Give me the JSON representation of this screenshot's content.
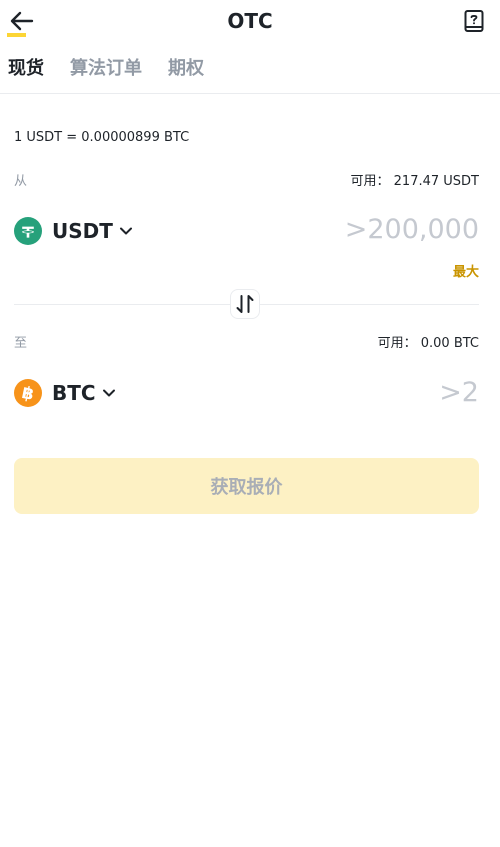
{
  "header": {
    "title": "OTC",
    "back_icon": "arrow-left-icon",
    "guide_icon": "book-question-icon"
  },
  "tabs": [
    {
      "label": "现货",
      "active": true
    },
    {
      "label": "算法订单",
      "active": false
    },
    {
      "label": "期权",
      "active": false
    }
  ],
  "rate_text": "1 USDT = 0.00000899 BTC",
  "from": {
    "label": "从",
    "available": "可用： 217.47 USDT",
    "coin": "USDT",
    "coin_icon": "tether-icon",
    "coin_color": "#26a17b",
    "amount_placeholder": ">200,000",
    "max_label": "最大"
  },
  "to": {
    "label": "至",
    "available": "可用： 0.00 BTC",
    "coin": "BTC",
    "coin_icon": "bitcoin-icon",
    "coin_color": "#f7931a",
    "amount_placeholder": ">2"
  },
  "swap_icon": "swap-vertical-icon",
  "quote_button": "获取报价",
  "colors": {
    "accent": "#fcd535",
    "max_link": "#c99400",
    "button_disabled_bg": "#fdf1c4"
  }
}
